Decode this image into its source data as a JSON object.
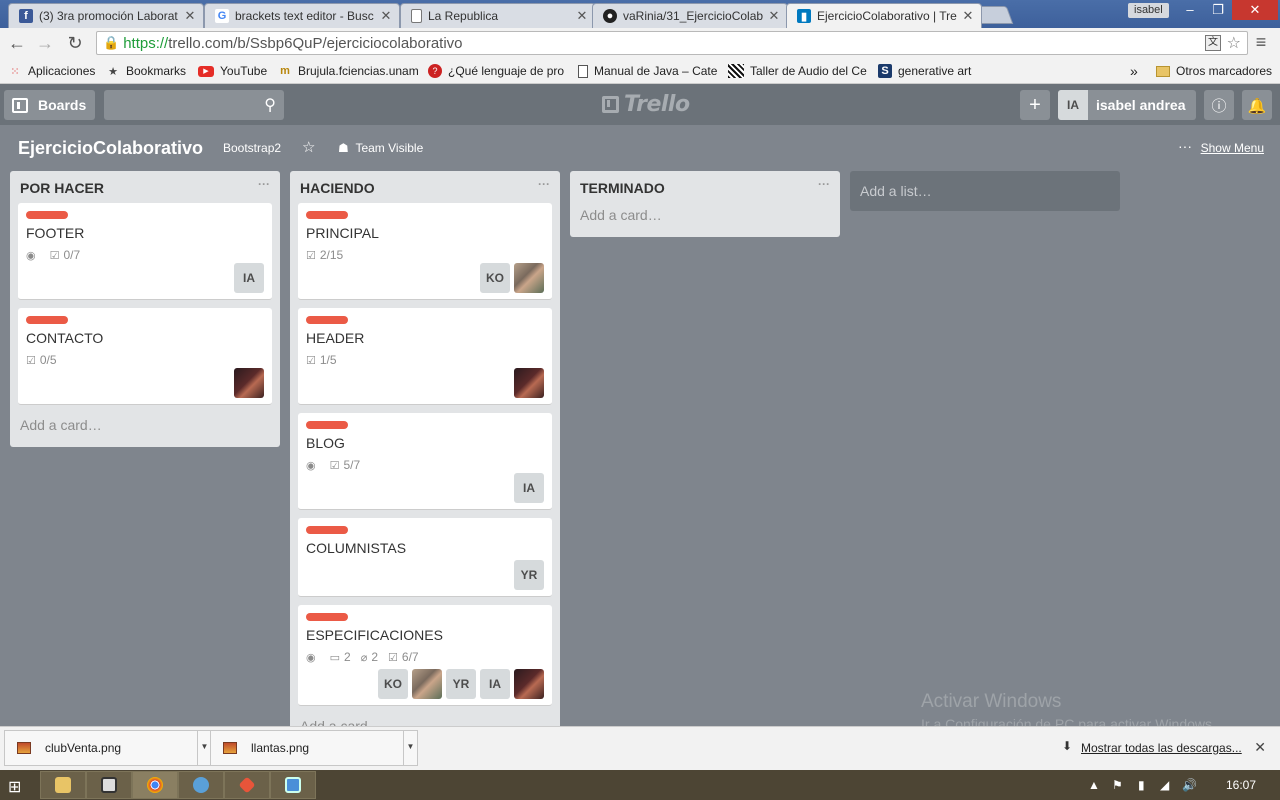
{
  "browser": {
    "tabs": [
      {
        "title": "(3) 3ra promoción Laborat",
        "icon": "facebook-icon"
      },
      {
        "title": "brackets text editor - Busc",
        "icon": "google-icon"
      },
      {
        "title": "La Republica",
        "icon": "page-icon"
      },
      {
        "title": "vaRinia/31_EjercicioColab",
        "icon": "github-icon"
      },
      {
        "title": "EjercicioColaborativo | Tre",
        "icon": "trello-icon"
      }
    ],
    "profile": "isabel",
    "url_scheme": "https://",
    "url_rest": "trello.com/b/Ssbp6QuP/ejerciciocolaborativo",
    "bookmarks": [
      {
        "label": "Aplicaciones",
        "icon": "apps-icon"
      },
      {
        "label": "Bookmarks",
        "icon": "star-icon"
      },
      {
        "label": "YouTube",
        "icon": "youtube-icon"
      },
      {
        "label": "Brujula.fciencias.unam",
        "icon": "brujula-icon"
      },
      {
        "label": "¿Qué lenguaje de pro",
        "icon": "question-icon"
      },
      {
        "label": "Manual de Java – Cate",
        "icon": "page-icon"
      },
      {
        "label": "Taller de Audio del Ce",
        "icon": "audio-icon"
      },
      {
        "label": "generative art",
        "icon": "generative-icon"
      }
    ],
    "other_bookmarks": "Otros marcadores",
    "more_bookmarks": "»"
  },
  "header": {
    "boards_label": "Boards",
    "logo_text": "Trello",
    "user_initials": "IA",
    "user_name": "isabel andrea"
  },
  "board": {
    "title": "EjercicioColaborativo",
    "team": "Bootstrap2",
    "visibility": "Team Visible",
    "show_menu": "Show Menu",
    "add_list": "Add a list…"
  },
  "lists": [
    {
      "name": "POR HACER",
      "add_card": "Add a card…",
      "cards": [
        {
          "title": "FOOTER",
          "watch": true,
          "checklist": "0/7",
          "members": [
            "IA"
          ]
        },
        {
          "title": "CONTACTO",
          "watch": false,
          "checklist": "0/5",
          "members": [
            "photo"
          ]
        }
      ]
    },
    {
      "name": "HACIENDO",
      "add_card": "Add a card…",
      "cards": [
        {
          "title": "PRINCIPAL",
          "watch": false,
          "checklist": "2/15",
          "members": [
            "KO",
            "photo2"
          ]
        },
        {
          "title": "HEADER",
          "watch": false,
          "checklist": "1/5",
          "members": [
            "photo"
          ]
        },
        {
          "title": "BLOG",
          "watch": true,
          "checklist": "5/7",
          "members": [
            "IA"
          ]
        },
        {
          "title": "COLUMNISTAS",
          "watch": false,
          "checklist": "",
          "members": [
            "YR"
          ]
        },
        {
          "title": "ESPECIFICACIONES",
          "watch": true,
          "comments": "2",
          "attachments": "2",
          "checklist": "6/7",
          "members": [
            "KO",
            "photo2",
            "YR",
            "IA",
            "photo"
          ]
        }
      ]
    },
    {
      "name": "TERMINADO",
      "add_card": "Add a card…",
      "cards": []
    }
  ],
  "watermark": {
    "line1": "Activar Windows",
    "line2": "Ir a Configuración de PC para activar Windows."
  },
  "downloads": {
    "items": [
      "clubVenta.png",
      "llantas.png"
    ],
    "show_all": "Mostrar todas las descargas..."
  },
  "taskbar": {
    "clock": "16:07"
  },
  "colors": {
    "board_bg": "#7f858d",
    "label_red": "#eb5a46",
    "header_bg": "#6b7279"
  }
}
